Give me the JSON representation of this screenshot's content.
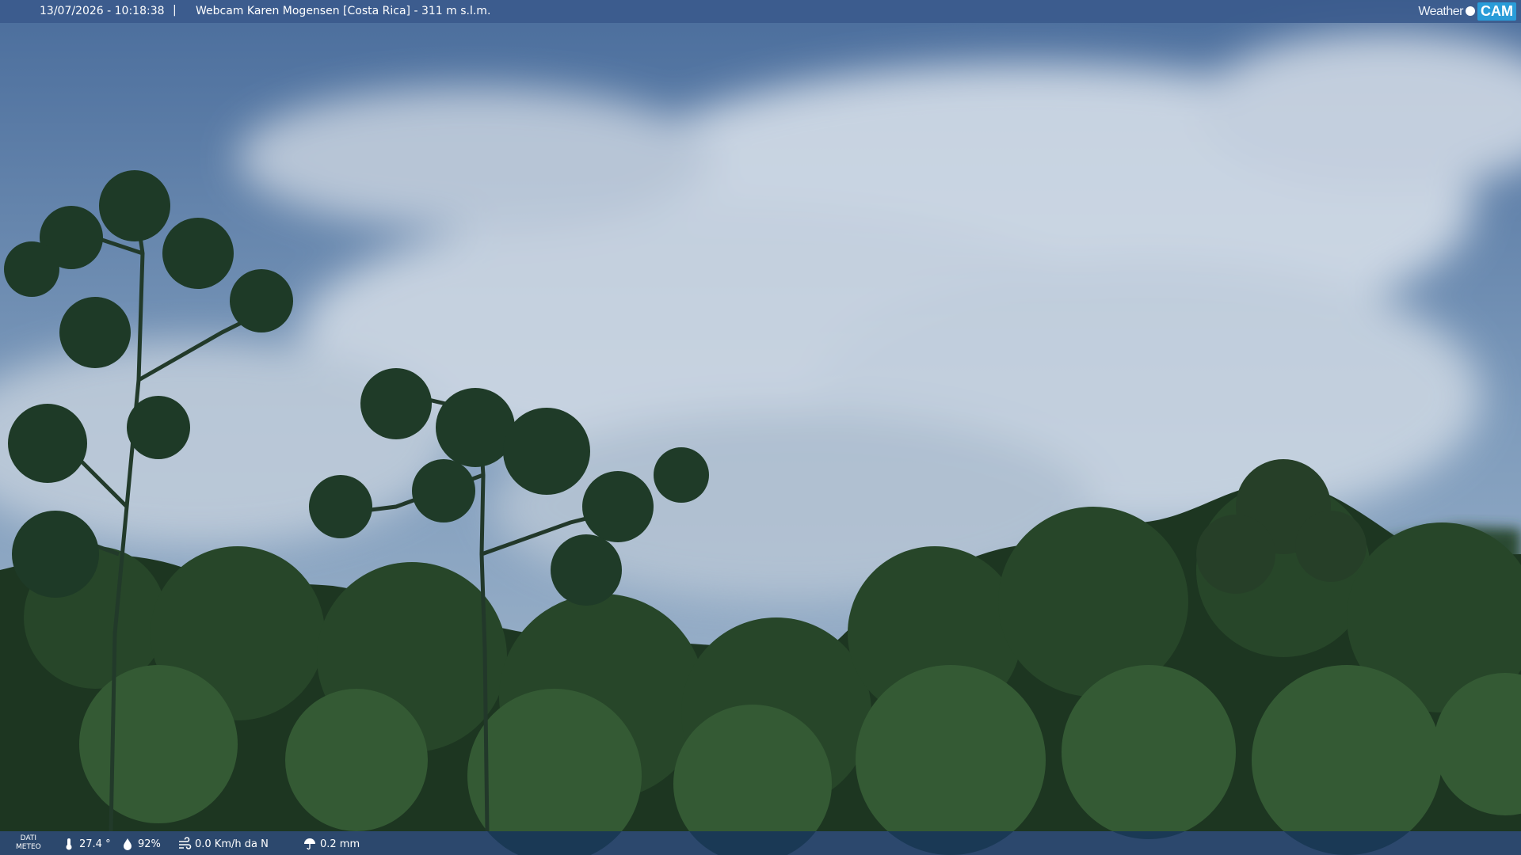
{
  "header": {
    "timestamp": "13/07/2026 - 10:18:38",
    "separator": "|",
    "camera_title": "Webcam Karen Mogensen [Costa Rica] - 311 m s.l.m."
  },
  "logo": {
    "left": "Weather",
    "right": "CAM"
  },
  "weather": {
    "label_line1": "DATI",
    "label_line2": "METEO",
    "temperature": "27.4 °",
    "humidity": "92%",
    "wind": "0.0 Km/h da N",
    "rain": "0.2 mm"
  },
  "colors": {
    "sky": "#5b7ea6",
    "cloud": "#dfe6ee",
    "forest": "#1f3a22",
    "bar": "#3a5a8c"
  }
}
